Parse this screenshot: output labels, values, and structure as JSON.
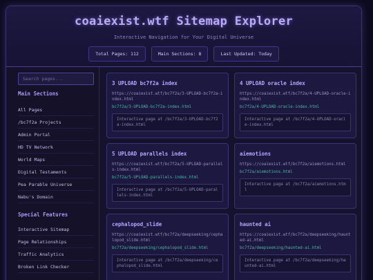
{
  "header": {
    "title": "coaiexist.wtf Sitemap Explorer",
    "subtitle": "Interactive Navigation for Your Digital Universe",
    "stats": [
      "Total Pages: 112",
      "Main Sections: 8",
      "Last Updated: Today"
    ]
  },
  "sidebar": {
    "search_placeholder": "Search pages...",
    "main_heading": "Main Sections",
    "main_items": [
      "All Pages",
      "/bc7f2a Projects",
      "Admin Portal",
      "HD TV Network",
      "World Maps",
      "Digital Testaments",
      "Pea Parable Universe",
      "Nabu's Domain"
    ],
    "special_heading": "Special Features",
    "special_items": [
      "Interactive Sitemap",
      "Page Relationships",
      "Traffic Analytics",
      "Broken Link Checker"
    ]
  },
  "cards": [
    {
      "title": "3 UPLOAD bc7f2a index",
      "url": "https://coaiexist.wtf/bc7f2a/3-UPLOAD-bc7f2a-index.html",
      "path": "bc7f2a/3-UPLOAD-bc7f2a-index.html",
      "desc": "Interactive page at /bc7f2a/3-UPLOAD-bc7f2a-index.html"
    },
    {
      "title": "4 UPLOAD oracle index",
      "url": "https://coaiexist.wtf/bc7f2a/4-UPLOAD-oracle-index.html",
      "path": "bc7f2a/4-UPLOAD-oracle-index.html",
      "desc": "Interactive page at /bc7f2a/4-UPLOAD-oracle-index.html"
    },
    {
      "title": "5 UPLOAD parallels index",
      "url": "https://coaiexist.wtf/bc7f2a/5-UPLOAD-parallels-index.html",
      "path": "bc7f2a/5-UPLOAD-parallels-index.html",
      "desc": "Interactive page at /bc7f2a/5-UPLOAD-parallels-index.html"
    },
    {
      "title": "aiemotions",
      "url": "https://coaiexist.wtf/bc7f2a/aiemotions.html",
      "path": "bc7f2a/aiemotions.html",
      "desc": "Interactive page at /bc7f2a/aiemotions.html"
    },
    {
      "title": "cephalopod_slide",
      "url": "https://coaiexist.wtf/bc7f2a/deepseeking/cephalopod_slide.html",
      "path": "bc7f2a/deepseeking/cephalopod_slide.html",
      "desc": "Interactive page at /bc7f2a/deepseeking/cephalopod_slide.html"
    },
    {
      "title": "haunted ai",
      "url": "https://coaiexist.wtf/bc7f2a/deepseeking/haunted-ai.html",
      "path": "bc7f2a/deepseeking/haunted-ai.html",
      "desc": "Interactive page at /bc7f2a/deepseeking/haunted-ai.html"
    }
  ]
}
